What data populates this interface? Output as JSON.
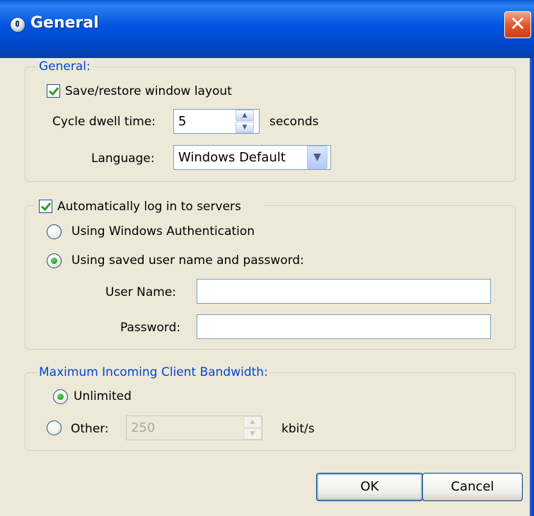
{
  "window": {
    "title": "General",
    "close_label": "✕"
  },
  "general_group": {
    "legend": "General:",
    "save_restore_label": "Save/restore window layout",
    "save_restore_checked": true,
    "cycle_dwell_label": "Cycle dwell time:",
    "cycle_dwell_value": "5",
    "cycle_dwell_unit": "seconds",
    "language_label": "Language:",
    "language_value": "Windows Default"
  },
  "login_group": {
    "legend": "Automatically log in to servers",
    "auto_login_checked": true,
    "windows_auth_label": "Using Windows Authentication",
    "windows_auth_selected": false,
    "saved_creds_label": "Using saved user name and password:",
    "saved_creds_selected": true,
    "username_label": "User Name:",
    "username_value": "",
    "password_label": "Password:",
    "password_value": ""
  },
  "bandwidth_group": {
    "legend": "Maximum Incoming Client Bandwidth:",
    "unlimited_label": "Unlimited",
    "unlimited_selected": true,
    "other_label": "Other:",
    "other_selected": false,
    "other_value": "250",
    "other_unit": "kbit/s"
  },
  "buttons": {
    "ok_label": "OK",
    "cancel_label": "Cancel"
  },
  "colors": {
    "titlebar": "#0053e0",
    "dialog_background": "#ece9d8",
    "group_legend_blue": "#0046d5",
    "check_mark_green": "#21a121"
  }
}
